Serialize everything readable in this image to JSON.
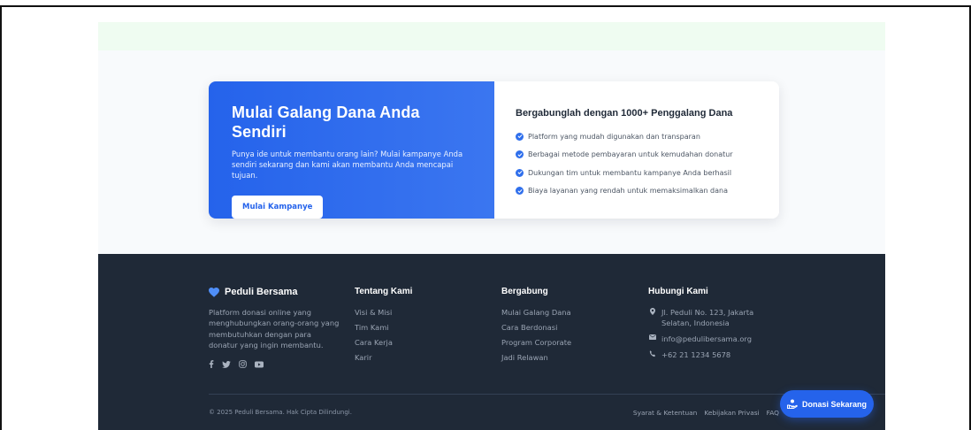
{
  "cta": {
    "title": "Mulai Galang Dana Anda Sendiri",
    "description": "Punya ide untuk membantu orang lain? Mulai kampanye Anda sendiri sekarang dan kami akan membantu Anda mencapai tujuan.",
    "button_label": "Mulai Kampanye",
    "right_title": "Bergabunglah dengan 1000+ Penggalang Dana",
    "benefits": [
      "Platform yang mudah digunakan dan transparan",
      "Berbagai metode pembayaran untuk kemudahan donatur",
      "Dukungan tim untuk membantu kampanye Anda berhasil",
      "Biaya layanan yang rendah untuk memaksimalkan dana"
    ]
  },
  "footer": {
    "brand": {
      "name": "Peduli Bersama",
      "description": "Platform donasi online yang menghubungkan orang-orang yang membutuhkan dengan para donatur yang ingin membantu.",
      "socials": [
        "facebook-icon",
        "twitter-icon",
        "instagram-icon",
        "youtube-icon"
      ]
    },
    "about": {
      "title": "Tentang Kami",
      "links": [
        "Visi & Misi",
        "Tim Kami",
        "Cara Kerja",
        "Karir"
      ]
    },
    "join": {
      "title": "Bergabung",
      "links": [
        "Mulai Galang Dana",
        "Cara Berdonasi",
        "Program Corporate",
        "Jadi Relawan"
      ]
    },
    "contact": {
      "title": "Hubungi Kami",
      "address": "Jl. Peduli No. 123, Jakarta Selatan, Indonesia",
      "email": "info@pedulibersama.org",
      "phone": "+62 21 1234 5678"
    },
    "copyright": "© 2025 Peduli Bersama. Hak Cipta Dilindungi.",
    "legal": [
      "Syarat & Ketentuan",
      "Kebijakan Privasi",
      "FAQ"
    ]
  },
  "fab": {
    "label": "Donasi Sekarang"
  },
  "colors": {
    "primary": "#2563eb",
    "footer_bg": "#1f2937",
    "page_bg": "#f8fafc",
    "band": "#effcf1"
  }
}
